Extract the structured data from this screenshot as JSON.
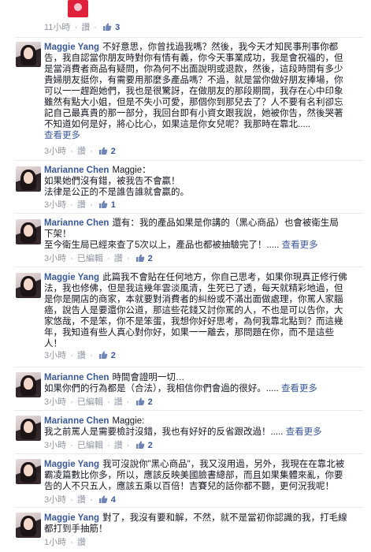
{
  "meta_labels": {
    "separator": "·",
    "like": "讚",
    "edited": "已編輯",
    "see_more": "查看更多"
  },
  "comments": [
    {
      "id": "c0",
      "time": "11小時",
      "likes": "3"
    },
    {
      "id": "c1",
      "name": "Maggie Yang",
      "lines": [
        "不好意思，你曾找過我嗎？然後，我今天才知民事刑事你都",
        "告，我自認當你朋友時對你有情有義，你今天事業成功，我是會祝福的，但",
        "是當消費者商品有疑問，你為何不出面說明或退款，然後，這段時間有多少",
        "貴婦朋友挺你，有需要用那麼多產品嗎？不過，就是當你做好朋友捧場，你",
        "可以一一趕跑她們，我也是很驚訝，在做朋友的那段期間，我存在心中印象",
        "雖然有點大小姐，但是不失小可愛，那個你到那兒去了？人不要有名利卻忘",
        "記自己最真貴的那一部分，我回台即有小資女跟我說，她被你告，然後哭著",
        "不知道如何是好，將心比心，如果這是你女兒呢？我那時在靠北....."
      ],
      "see_more": "查看更多",
      "time": "3小時",
      "likes": "2"
    },
    {
      "id": "c2",
      "name": "Marianne Chen",
      "lines": [
        "Maggie：",
        "如果她們沒有錯，被我告不會贏！",
        "法律是公正的不是誰告誰就會贏的。"
      ],
      "time": "3小時",
      "likes": "1"
    },
    {
      "id": "c3",
      "name": "Marianne Chen",
      "lines": [
        "還有：我的產品如果是你講的（黑心商品）也會被衛生局",
        "下架！",
        "至今衛生局已經來查了5次以上，產品也都被抽驗完了！....."
      ],
      "see_more": "查看更多",
      "time": "3小時",
      "edited": true,
      "likes": "2"
    },
    {
      "id": "c4",
      "name": "Maggie Yang",
      "lines": [
        "此篇我不會貼在任何地方，你自己思考，如果你現真正修行佛",
        "法，我也修佛，但是我這幾年雲淡風清，生死已了透，每天就精彩地過，但",
        "是你是開店的商家，本就要對消費者的糾紛或不滿出面做處理，你罵人家腦",
        "癌，說告人是要還你公道，那這些花錢又討你罵的人，不也是可以告你，大",
        "家悠哉，不是笨，你不是笨蛋，我想你好好思考，為何我靠北點到？而這幾",
        "年，我知道有些人真心對你好，如果一一離去，那問題在你，而不是這些",
        "人！"
      ],
      "time": "3小時",
      "likes": "2"
    },
    {
      "id": "c5",
      "name": "Marianne Chen",
      "lines": [
        "時間會證明一切…",
        "如果你們的行為都是（合法），我相信你們會過的很好。....."
      ],
      "see_more": "查看更多",
      "time": "3小時",
      "edited": true,
      "likes": "2"
    },
    {
      "id": "c6",
      "name": "Marianne Chen",
      "lines": [
        "Maggie:",
        "我之前罵人是需要檢討沒錯，我也有好好的反省跟改過！....."
      ],
      "see_more": "查看更多",
      "time": "3小時",
      "edited": true,
      "likes": "2"
    },
    {
      "id": "c7",
      "name": "Maggie Yang",
      "lines": [
        "我可沒說你\"黑心商品\"，我又沒用過，另外，我現在在靠北被",
        "霸凌篇數比你多，所以，應該反映美國臉書總部，而且如果集體來亂，你要",
        "告的人不只五人，應該五乘以百倍！吉賽兒的話你都不聽，更何況我呢！"
      ],
      "time": "3小時",
      "likes": "4"
    },
    {
      "id": "c8",
      "name": "Maggie Yang",
      "lines": [
        "對了，我沒有要和解，不然，就不是當初你認識的我，打毛線",
        "都打到手抽筋！"
      ],
      "time": "1小時"
    }
  ]
}
